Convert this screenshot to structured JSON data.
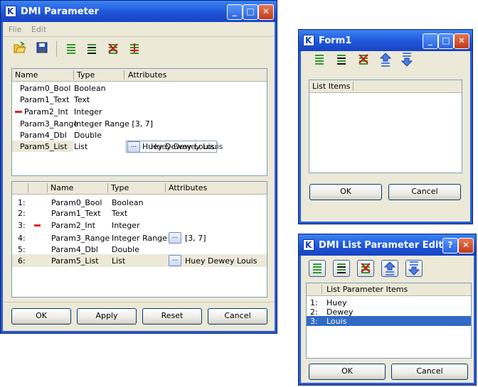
{
  "dmi": {
    "title": "DMI Parameter",
    "menu": [
      "File",
      "Edit"
    ],
    "table1": {
      "headers": [
        "Name",
        "Type",
        "Attributes"
      ],
      "rows": [
        {
          "name": "Param0_Bool",
          "type": "Boolean",
          "attr": "",
          "flag": false
        },
        {
          "name": "Param1_Text",
          "type": "Text",
          "attr": "",
          "flag": false
        },
        {
          "name": "Param2_Int",
          "type": "Integer",
          "attr": "",
          "flag": true
        },
        {
          "name": "Param3_Range",
          "type": "Integer Range [3, 7]",
          "attr": "",
          "flag": false
        },
        {
          "name": "Param4_Dbl",
          "type": "Double",
          "attr": "",
          "flag": false
        },
        {
          "name": "Param5_List",
          "type": "List",
          "attr": "Huey Dewey Louis",
          "flag": false
        }
      ],
      "edit_button": "...",
      "edit_overlap_text": "Huey Dewey Louis"
    },
    "table2": {
      "headers": [
        "Name",
        "Type",
        "Attributes"
      ],
      "rows": [
        {
          "index": "1:",
          "name": "Param0_Bool",
          "type": "Boolean",
          "attr": "",
          "flag": false
        },
        {
          "index": "2:",
          "name": "Param1_Text",
          "type": "Text",
          "attr": "",
          "flag": false
        },
        {
          "index": "3:",
          "name": "Param2_Int",
          "type": "Integer",
          "attr": "",
          "flag": true
        },
        {
          "index": "4:",
          "name": "Param3_Range",
          "type": "Integer Range",
          "attr": "[3, 7]",
          "flag": false
        },
        {
          "index": "5:",
          "name": "Param4_Dbl",
          "type": "Double",
          "attr": "",
          "flag": false
        },
        {
          "index": "6:",
          "name": "Param5_List",
          "type": "List",
          "attr": "Huey Dewey Louis",
          "flag": false
        }
      ],
      "edit_button": "..."
    },
    "buttons": {
      "ok": "OK",
      "apply": "Apply",
      "reset": "Reset",
      "cancel": "Cancel"
    }
  },
  "form1": {
    "title": "Form1",
    "header": "List Items",
    "buttons": {
      "ok": "OK",
      "cancel": "Cancel"
    }
  },
  "list_editor": {
    "title": "DMI List Parameter Editor",
    "help": "?",
    "header": "List Parameter Items",
    "items": [
      {
        "index": "1:",
        "value": "Huey"
      },
      {
        "index": "2:",
        "value": "Dewey"
      },
      {
        "index": "3:",
        "value": "Louis"
      }
    ],
    "selected_index": 2,
    "buttons": {
      "ok": "OK",
      "cancel": "Cancel"
    }
  },
  "colors": {
    "titlebar": "#2a5bd7",
    "selection": "#316ac5",
    "flag": "#e02020",
    "green": "#2e9a2e",
    "row_highlight": "#ece9d8"
  },
  "icons": [
    "app-icon",
    "open-folder-icon",
    "save-icon",
    "add-row-icon",
    "insert-row-icon",
    "delete-row-icon",
    "move-row-icon",
    "move-up-icon",
    "move-down-icon"
  ]
}
